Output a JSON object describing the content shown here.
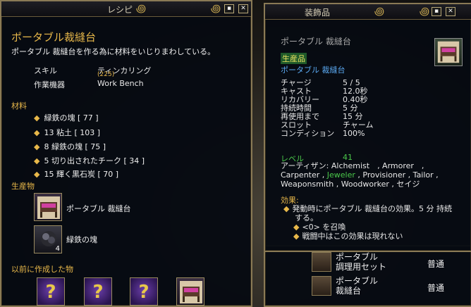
{
  "recipe": {
    "window_title": "レシピ",
    "item_name": "ポータブル裁縫台",
    "description": "ポータブル 裁縫台を作る為に材料をいじりまわしている。",
    "skill_label": "スキル",
    "skill_value": "ティンカリング",
    "skill_sub": "(225)",
    "station_label": "作業機器",
    "station_value": "Work Bench",
    "materials_header": "材料",
    "materials": [
      "緑鉄の塊 [ 77 ]",
      "13 粘土 [ 103 ]",
      "8 緑鉄の塊 [ 75 ]",
      "5 切り出されたチーク [ 34 ]",
      "15 輝く黒石炭 [ 70 ]"
    ],
    "products_header": "生産物",
    "products": [
      {
        "name": "ポータブル 裁縫台",
        "qty": ""
      },
      {
        "name": "緑鉄の塊",
        "qty": "4"
      }
    ],
    "previous_header": "以前に作成した物",
    "previous_slots": [
      "?",
      "?",
      "?"
    ]
  },
  "tooltip": {
    "window_title": "装飾品",
    "item_name": "ポータブル 裁縫台",
    "badge": "生産品",
    "subtitle": "ポータブル 裁縫台",
    "stats": [
      {
        "label": "チャージ",
        "value": "5 / 5"
      },
      {
        "label": "キャスト",
        "value": "12.0秒"
      },
      {
        "label": "リカバリー",
        "value": "0.40秒"
      },
      {
        "label": "持続時間",
        "value": "5 分"
      },
      {
        "label": "再使用まで",
        "value": "15 分"
      },
      {
        "label": "スロット",
        "value": "チャーム"
      },
      {
        "label": "コンディション",
        "value": "100%"
      }
    ],
    "level_label": "レベル",
    "level_value": "41",
    "artisan_line1_prefix": "アーティザン: Alchemist　, Armorer　,",
    "artisan_line2_prefix": "Carpenter ,",
    "artisan_line2_highlight": " Jeweler ",
    "artisan_line2_suffix": ", Provisioner , Tailor ,",
    "artisan_line3": "Weaponsmith , Woodworker , セイジ",
    "effects_header": "効果:",
    "effect_main_1": "発動時にポータブル 裁縫台の効果。5 分 持続",
    "effect_main_2": "する。",
    "effect_sub_1": "<0> を召喚",
    "effect_sub_2": "戦闘中はこの効果は現れない"
  },
  "list": {
    "rows": [
      {
        "name_1": "ポータブル",
        "name_2": "調理用セット",
        "grade": "普通"
      },
      {
        "name_1": "ポータブル",
        "name_2": "裁縫台",
        "grade": "普通"
      }
    ]
  },
  "buttons": {
    "minimize": "▪",
    "close": "✕"
  },
  "colors": {
    "accent_gold": "#e8b84a",
    "green": "#4ac84a",
    "blue": "#5aa8f0",
    "frame": "#8a7a55"
  }
}
